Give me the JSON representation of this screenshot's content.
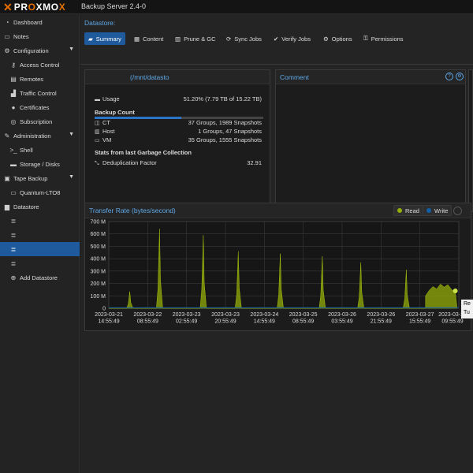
{
  "header": {
    "logo_text_a": "PR",
    "logo_text_b": "O",
    "logo_text_c": "XMO",
    "logo_text_d": "X",
    "product": "Backup Server 2.4-0"
  },
  "sidebar": {
    "items": [
      {
        "label": "Dashboard",
        "icon": "tachometer-icon",
        "glyph": "◔"
      },
      {
        "label": "Notes",
        "icon": "notes-icon",
        "glyph": "▭"
      },
      {
        "label": "Configuration",
        "icon": "gears-icon",
        "glyph": "⚙"
      },
      {
        "label": "Access Control",
        "icon": "key-icon",
        "glyph": "⚷"
      },
      {
        "label": "Remotes",
        "icon": "server-icon",
        "glyph": "▤"
      },
      {
        "label": "Traffic Control",
        "icon": "signal-icon",
        "glyph": "▟"
      },
      {
        "label": "Certificates",
        "icon": "certificate-icon",
        "glyph": "●"
      },
      {
        "label": "Subscription",
        "icon": "lifebuoy-icon",
        "glyph": "◎"
      },
      {
        "label": "Administration",
        "icon": "wrench-icon",
        "glyph": "✎"
      },
      {
        "label": "Shell",
        "icon": "terminal-icon",
        "glyph": ">_"
      },
      {
        "label": "Storage / Disks",
        "icon": "hdd-icon",
        "glyph": "▬"
      },
      {
        "label": "Tape Backup",
        "icon": "tape-icon",
        "glyph": "▣"
      },
      {
        "label": "Quantum-LTO8",
        "icon": "tape-drive-icon",
        "glyph": "▭"
      },
      {
        "label": "Datastore",
        "icon": "archive-icon",
        "glyph": "▆"
      },
      {
        "label": "",
        "icon": "database-icon",
        "glyph": "≣"
      },
      {
        "label": "",
        "icon": "database-icon",
        "glyph": "≣"
      },
      {
        "label": "",
        "icon": "database-icon",
        "glyph": "≣"
      },
      {
        "label": "",
        "icon": "database-icon",
        "glyph": "≣"
      },
      {
        "label": "Add Datastore",
        "icon": "plus-circle-icon",
        "glyph": "⊕"
      }
    ]
  },
  "datastore": {
    "title": "Datastore:",
    "tabs": [
      {
        "label": "Summary",
        "icon": "book-icon",
        "glyph": "▰"
      },
      {
        "label": "Content",
        "icon": "th-icon",
        "glyph": "▦"
      },
      {
        "label": "Prune & GC",
        "icon": "trash-icon",
        "glyph": "▥"
      },
      {
        "label": "Sync Jobs",
        "icon": "refresh-icon",
        "glyph": "⟳"
      },
      {
        "label": "Verify Jobs",
        "icon": "check-circle-icon",
        "glyph": "✔"
      },
      {
        "label": "Options",
        "icon": "gear-icon",
        "glyph": "⚙"
      },
      {
        "label": "Permissions",
        "icon": "unlock-icon",
        "glyph": "⚿"
      }
    ]
  },
  "info": {
    "title": "(/mnt/datastore",
    "usage_label": "Usage",
    "usage_value": "51.20% (7.79 TB of 15.22 TB)",
    "usage_fraction": 0.512,
    "backup_count_label": "Backup Count",
    "ct_label": "CT",
    "ct_value": "37 Groups, 1989 Snapshots",
    "host_label": "Host",
    "host_value": "1 Groups, 47 Snapshots",
    "vm_label": "VM",
    "vm_value": "35 Groups, 1555 Snapshots",
    "gc_label": "Stats from last Garbage Collection",
    "dedup_label": "Deduplication Factor",
    "dedup_value": "32.91"
  },
  "comment": {
    "title": "Comment"
  },
  "tooltip": {
    "line1": "Re",
    "line2": "Tu"
  },
  "chart_data": {
    "type": "area",
    "title": "Transfer Rate (bytes/second)",
    "legend": [
      {
        "name": "Read",
        "color": "#94ae0a"
      },
      {
        "name": "Write",
        "color": "#115fa6"
      }
    ],
    "ylim": [
      0,
      700
    ],
    "yticks": [
      "0",
      "100 M",
      "200 M",
      "300 M",
      "400 M",
      "500 M",
      "600 M",
      "700 M"
    ],
    "xticks": [
      [
        "2023-03-21",
        "14:55:49"
      ],
      [
        "2023-03-22",
        "08:55:49"
      ],
      [
        "2023-03-23",
        "02:55:49"
      ],
      [
        "2023-03-23",
        "20:55:49"
      ],
      [
        "2023-03-24",
        "14:55:49"
      ],
      [
        "2023-03-25",
        "08:55:49"
      ],
      [
        "2023-03-26",
        "03:55:49"
      ],
      [
        "2023-03-26",
        "21:55:49"
      ],
      [
        "2023-03-27",
        "15:55:49"
      ],
      [
        "2023-03-28",
        "09:55:49"
      ]
    ],
    "read_peaks_M": [
      {
        "t": 0.04,
        "v": 0
      },
      {
        "t": 0.06,
        "v": 135
      },
      {
        "t": 0.145,
        "v": 640
      },
      {
        "t": 0.27,
        "v": 590
      },
      {
        "t": 0.37,
        "v": 460
      },
      {
        "t": 0.49,
        "v": 440
      },
      {
        "t": 0.61,
        "v": 420
      },
      {
        "t": 0.72,
        "v": 370
      },
      {
        "t": 0.85,
        "v": 310
      }
    ],
    "read_tail_M": [
      100,
      145,
      175,
      155,
      195,
      170,
      190,
      150,
      130
    ],
    "write_M": 8
  }
}
